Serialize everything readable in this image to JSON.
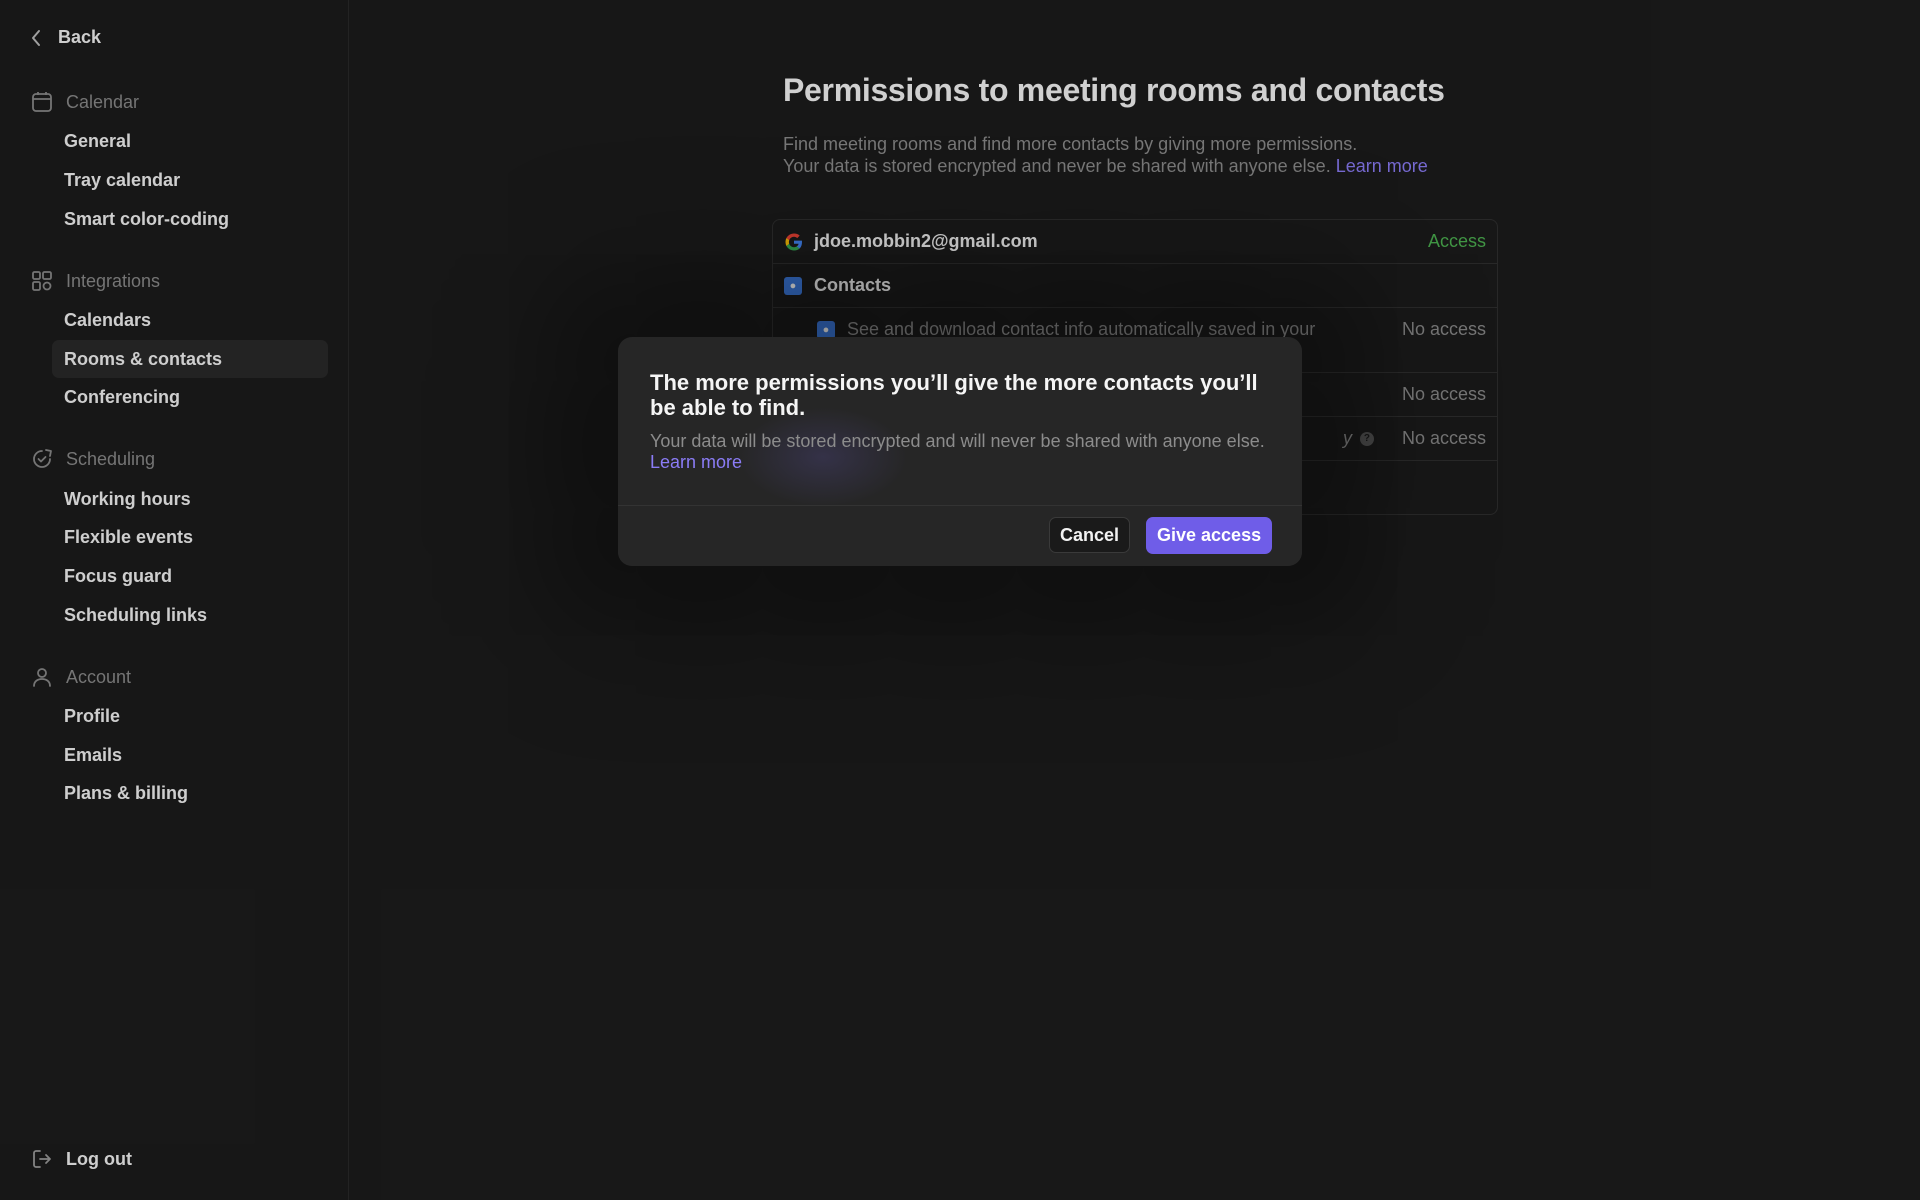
{
  "sidebar": {
    "back_label": "Back",
    "sections": [
      {
        "title": "Calendar",
        "items": [
          "General",
          "Tray calendar",
          "Smart color-coding"
        ]
      },
      {
        "title": "Integrations",
        "items": [
          "Calendars",
          "Rooms & contacts",
          "Conferencing"
        ]
      },
      {
        "title": "Scheduling",
        "items": [
          "Working hours",
          "Flexible events",
          "Focus guard",
          "Scheduling links"
        ]
      },
      {
        "title": "Account",
        "items": [
          "Profile",
          "Emails",
          "Plans & billing"
        ]
      }
    ],
    "active_item": "Rooms & contacts",
    "logout_label": "Log out"
  },
  "main": {
    "title": "Permissions to meeting rooms and contacts",
    "desc_line1": "Find meeting rooms and find more contacts by giving more permissions.",
    "desc_line2": "Your data is stored encrypted and never be shared with anyone else.",
    "learn_more": "Learn more",
    "account_email": "jdoe.mobbin2@gmail.com",
    "account_status": "Access",
    "contacts_label": "Contacts",
    "perm_1_text": "See and download contact info automatically saved in your",
    "perm_1_status": "No access",
    "perm_2_status": "No access",
    "perm_3_partial": "y",
    "perm_3_status": "No access"
  },
  "modal": {
    "title": "The more permissions you’ll give the more contacts you’ll be able to find.",
    "body": "Your data will be stored encrypted and will never be shared with anyone else.",
    "learn_more": "Learn more",
    "cancel_label": "Cancel",
    "confirm_label": "Give access"
  },
  "colors": {
    "accent": "#6f5de8",
    "link": "#8b7cf6",
    "access_green": "#4caf50",
    "background": "#1c1c1c"
  }
}
